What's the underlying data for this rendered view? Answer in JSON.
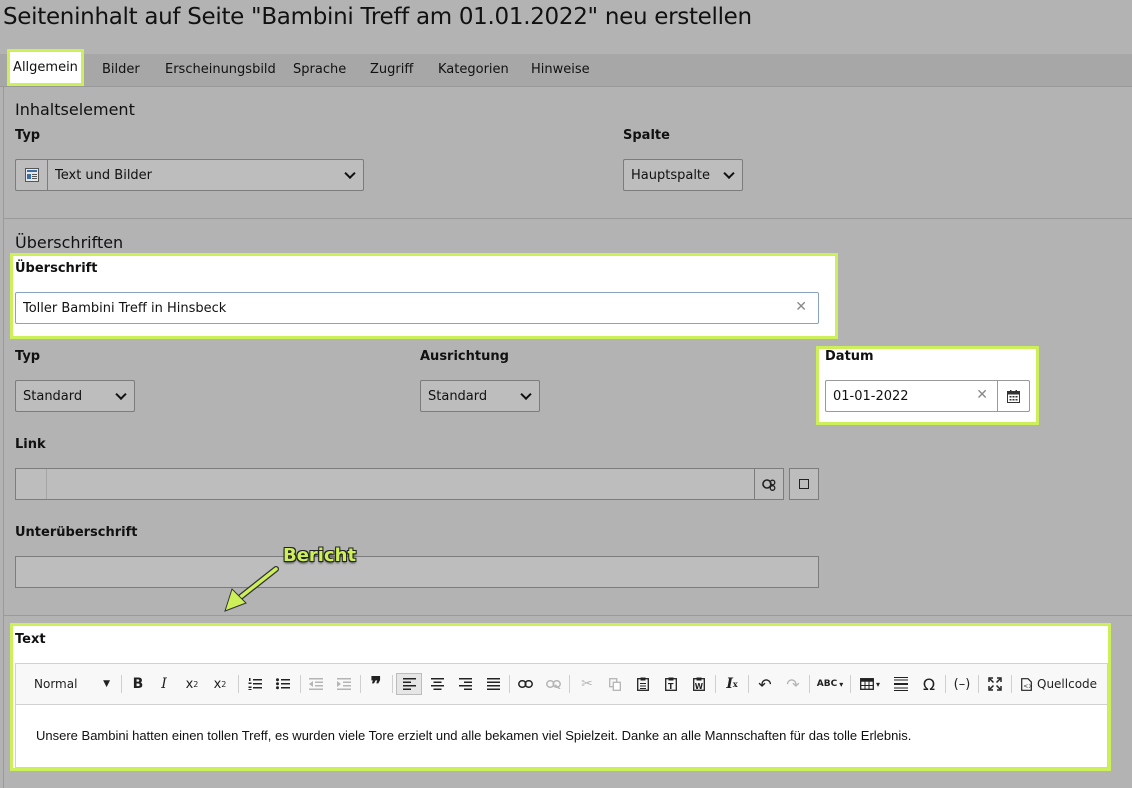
{
  "title": "Seiteninhalt auf Seite \"Bambini Treff am 01.01.2022\" neu erstellen",
  "tabs": [
    "Allgemein",
    "Bilder",
    "Erscheinungsbild",
    "Sprache",
    "Zugriff",
    "Kategorien",
    "Hinweise"
  ],
  "section_content": {
    "title": "Inhaltselement",
    "type_label": "Typ",
    "type_value": "Text und Bilder",
    "column_label": "Spalte",
    "column_value": "Hauptspalte"
  },
  "section_headings": {
    "title": "Überschriften",
    "header_label": "Überschrift",
    "header_value": "Toller Bambini Treff in Hinsbeck",
    "type_label": "Typ",
    "type_value": "Standard",
    "align_label": "Ausrichtung",
    "align_value": "Standard",
    "date_label": "Datum",
    "date_value": "01-01-2022",
    "link_label": "Link",
    "subheader_label": "Unterüberschrift"
  },
  "annotation": {
    "text": "Bericht",
    "color": "#cdf05a"
  },
  "text_field": {
    "label": "Text",
    "format_value": "Normal",
    "source_label": "Quellcode",
    "content": "Unsere Bambini hatten einen tollen Treff, es wurden viele Tore erzielt und alle bekamen viel Spielzeit. Danke an alle Mannschaften für das tolle Erlebnis."
  },
  "colors": {
    "highlight": "#cdf05a",
    "background": "#b3b3b3"
  }
}
